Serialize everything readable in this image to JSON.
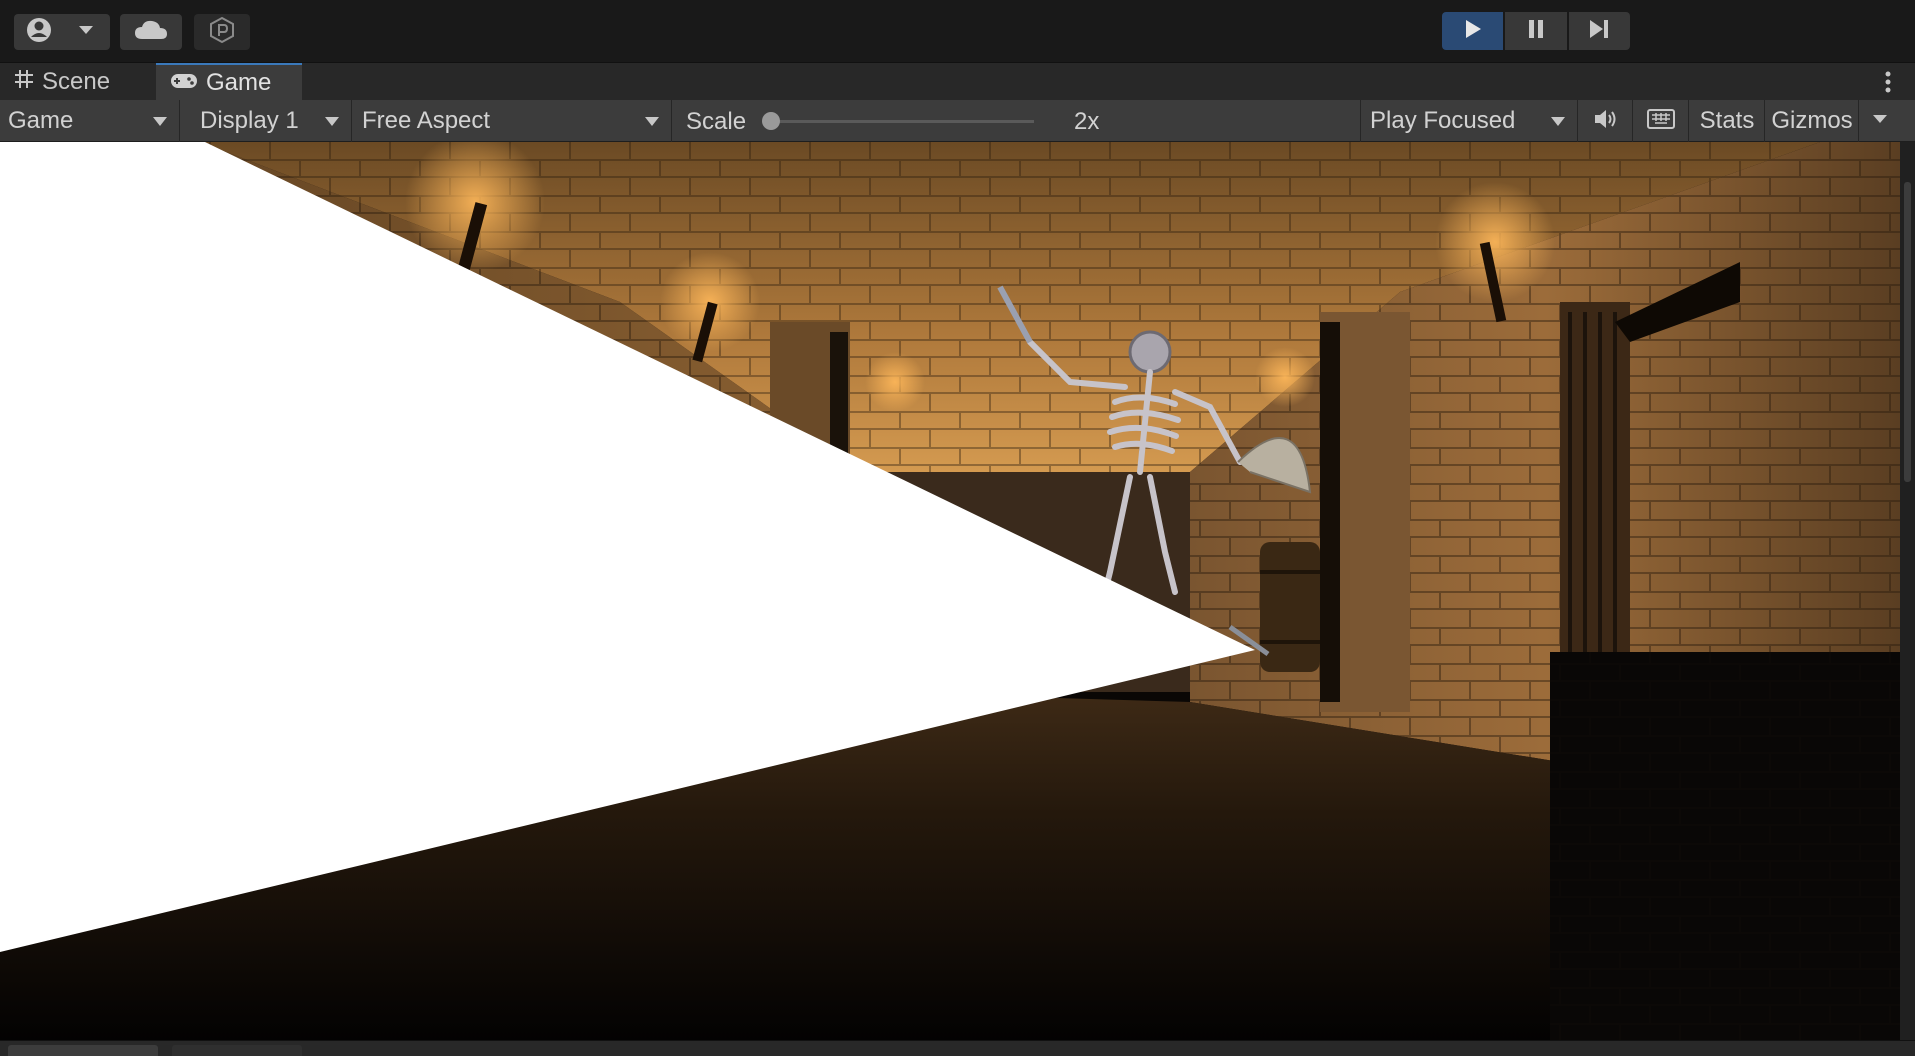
{
  "toolbar": {
    "account_icon": "account-icon",
    "cloud_icon": "cloud-icon",
    "collab_icon": "collab-icon",
    "play_icon": "play-icon",
    "pause_icon": "pause-icon",
    "step_icon": "step-icon",
    "play_active": true
  },
  "tabs": [
    {
      "label": "Scene",
      "icon": "grid-icon"
    },
    {
      "label": "Game",
      "icon": "gamepad-icon",
      "active": true
    }
  ],
  "game_toolbar": {
    "view_select": "Game",
    "display_select": "Display 1",
    "aspect_select": "Free Aspect",
    "scale_label": "Scale",
    "scale_value": "2x",
    "scale_level": 0.0,
    "play_mode_select": "Play Focused",
    "mute_icon": "speaker-icon",
    "keyboard_icon": "keyboard-icon",
    "stats_label": "Stats",
    "gizmos_label": "Gizmos"
  },
  "colors": {
    "accent_tab": "#3a79bb",
    "play_active_bg": "#2a4a74",
    "panel_bg": "#3c3c3c",
    "toolbar_bg": "#191919"
  }
}
